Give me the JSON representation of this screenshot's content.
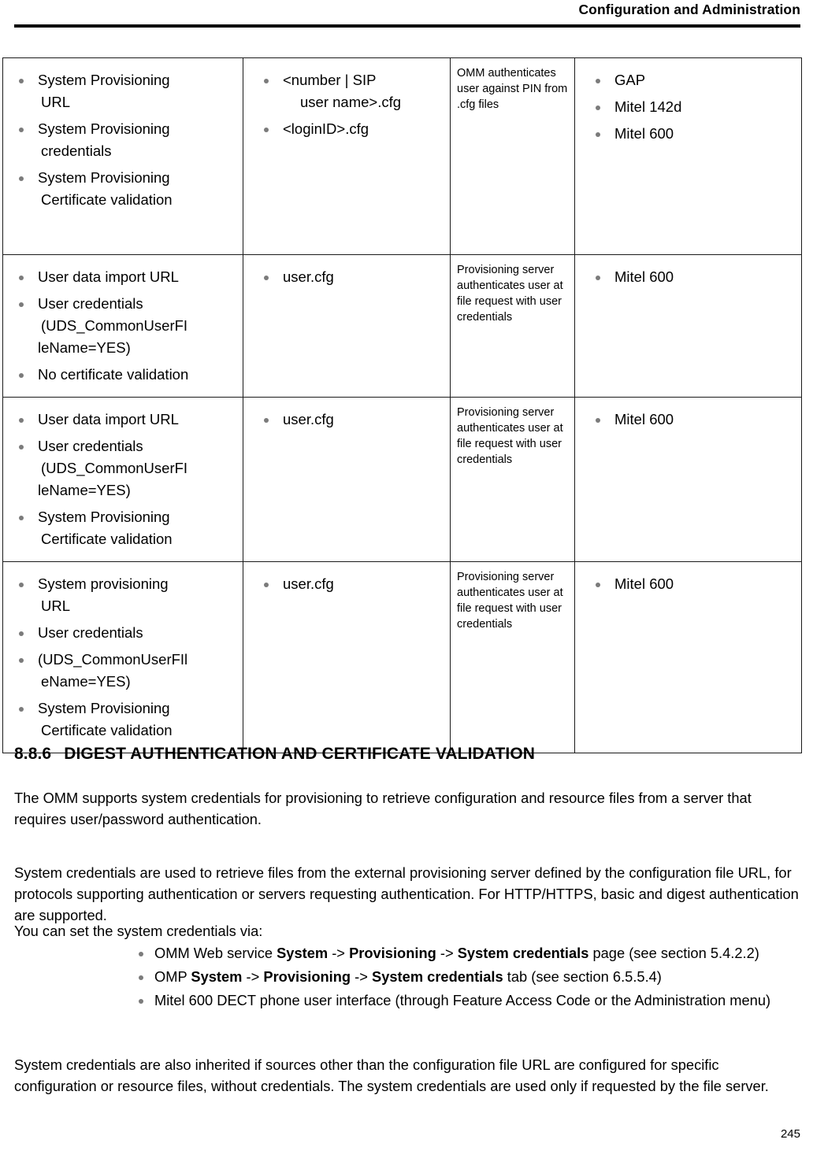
{
  "header": {
    "title": "Configuration and Administration"
  },
  "table": {
    "rows": [
      {
        "sources": [
          {
            "text": "System Provisioning",
            "cont": "URL",
            "cont_indent": "in1"
          },
          {
            "text": "System Provisioning",
            "cont": "credentials",
            "cont_indent": "in1"
          },
          {
            "text": "System Provisioning",
            "cont": "Certificate validation",
            "cont_indent": "in1"
          }
        ],
        "files": [
          {
            "text": "<number | SIP",
            "cont": "user name>.cfg",
            "cont_indent": "in2"
          },
          {
            "text": "<loginID>.cfg",
            "cont": "",
            "cont_indent": "in1"
          }
        ],
        "auth": "OMM authenticates user against PIN from .cfg files",
        "phones": [
          {
            "text": "GAP"
          },
          {
            "text": "Mitel 142d"
          },
          {
            "text": "Mitel 600"
          }
        ]
      },
      {
        "sources": [
          {
            "text": "User data import URL",
            "cont": "",
            "cont_indent": "in1"
          },
          {
            "text": "User credentials",
            "cont": "(UDS_CommonUserFI",
            "cont2": "leName=YES)",
            "cont_indent": "in1"
          },
          {
            "text": "No certificate validation",
            "cont": "",
            "cont_indent": "in1"
          }
        ],
        "files": [
          {
            "text": "user.cfg",
            "cont": "",
            "cont_indent": "in1"
          }
        ],
        "auth": "Provisioning server authenticates user at file request with user credentials",
        "phones": [
          {
            "text": "Mitel 600"
          }
        ]
      },
      {
        "sources": [
          {
            "text": "User data import URL",
            "cont": "",
            "cont_indent": "in1"
          },
          {
            "text": "User credentials",
            "cont": "(UDS_CommonUserFI",
            "cont2": "leName=YES)",
            "cont_indent": "in1"
          },
          {
            "text": "System Provisioning",
            "cont": "Certificate validation",
            "cont_indent": "in1"
          }
        ],
        "files": [
          {
            "text": "user.cfg",
            "cont": "",
            "cont_indent": "in1"
          }
        ],
        "auth": "Provisioning server authenticates user at file request with user credentials",
        "phones": [
          {
            "text": "Mitel 600"
          }
        ]
      },
      {
        "sources": [
          {
            "text": "System provisioning",
            "cont": "URL",
            "cont_indent": "in1"
          },
          {
            "text": "User credentials",
            "cont": "",
            "cont_indent": "in1"
          },
          {
            "text": "(UDS_CommonUserFIl",
            "cont": "eName=YES)",
            "cont_indent": "in1"
          },
          {
            "text": "System Provisioning",
            "cont": "Certificate validation",
            "cont_indent": "in1"
          }
        ],
        "files": [
          {
            "text": "user.cfg",
            "cont": "",
            "cont_indent": "in1"
          }
        ],
        "auth": "Provisioning server authenticates user at file request with user credentials",
        "phones": [
          {
            "text": "Mitel 600"
          }
        ]
      }
    ]
  },
  "section": {
    "number": "8.8.6",
    "title": "DIGEST AUTHENTICATION AND CERTIFICATE VALIDATION",
    "para1": "The OMM supports system credentials for provisioning to retrieve configuration and resource files from a server that requires user/password authentication.",
    "para2": "System credentials are used to retrieve files from the external provisioning server defined by the configuration file URL, for protocols supporting authentication or servers requesting authentication. For HTTP/HTTPS, basic and digest authentication are supported.",
    "para3": "You can set the system credentials via:",
    "bullets": [
      {
        "parts": [
          {
            "t": "OMM Web service ",
            "b": false
          },
          {
            "t": "System",
            "b": true
          },
          {
            "t": " -> ",
            "b": false
          },
          {
            "t": "Provisioning",
            "b": true
          },
          {
            "t": " -> ",
            "b": false
          },
          {
            "t": "System credentials",
            "b": true
          },
          {
            "t": " page (see section 5.4.2.2)",
            "b": false
          }
        ]
      },
      {
        "parts": [
          {
            "t": "OMP ",
            "b": false
          },
          {
            "t": "System",
            "b": true
          },
          {
            "t": " -> ",
            "b": false
          },
          {
            "t": "Provisioning",
            "b": true
          },
          {
            "t": " -> ",
            "b": false
          },
          {
            "t": "System credentials",
            "b": true
          },
          {
            "t": " tab (see section 6.5.5.4)",
            "b": false
          }
        ]
      },
      {
        "parts": [
          {
            "t": "Mitel 600 DECT phone user interface (through Feature Access Code or the Administration menu)",
            "b": false
          }
        ]
      }
    ],
    "para5": "System credentials are also inherited if sources other than the configuration file URL are configured for specific configuration or resource files, without credentials. The system credentials are used only if requested by the file server."
  },
  "footer": {
    "page_number": "245"
  }
}
